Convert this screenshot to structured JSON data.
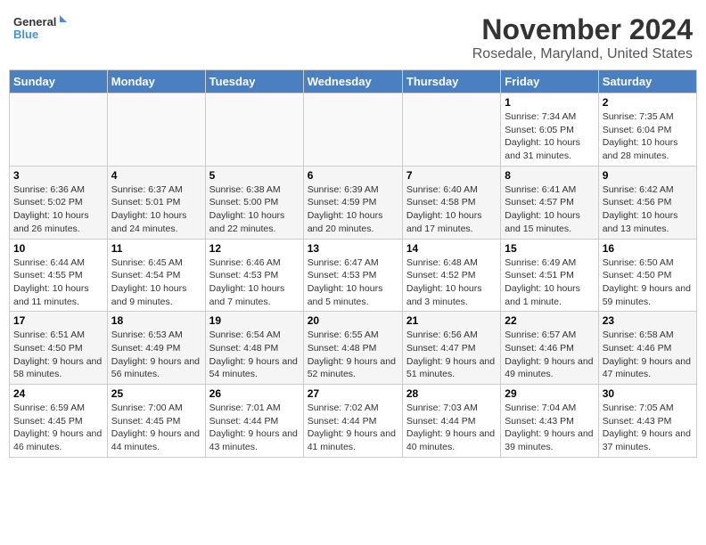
{
  "logo": {
    "general": "General",
    "blue": "Blue"
  },
  "title": "November 2024",
  "location": "Rosedale, Maryland, United States",
  "days_of_week": [
    "Sunday",
    "Monday",
    "Tuesday",
    "Wednesday",
    "Thursday",
    "Friday",
    "Saturday"
  ],
  "weeks": [
    [
      {
        "day": "",
        "detail": ""
      },
      {
        "day": "",
        "detail": ""
      },
      {
        "day": "",
        "detail": ""
      },
      {
        "day": "",
        "detail": ""
      },
      {
        "day": "",
        "detail": ""
      },
      {
        "day": "1",
        "detail": "Sunrise: 7:34 AM\nSunset: 6:05 PM\nDaylight: 10 hours and 31 minutes."
      },
      {
        "day": "2",
        "detail": "Sunrise: 7:35 AM\nSunset: 6:04 PM\nDaylight: 10 hours and 28 minutes."
      }
    ],
    [
      {
        "day": "3",
        "detail": "Sunrise: 6:36 AM\nSunset: 5:02 PM\nDaylight: 10 hours and 26 minutes."
      },
      {
        "day": "4",
        "detail": "Sunrise: 6:37 AM\nSunset: 5:01 PM\nDaylight: 10 hours and 24 minutes."
      },
      {
        "day": "5",
        "detail": "Sunrise: 6:38 AM\nSunset: 5:00 PM\nDaylight: 10 hours and 22 minutes."
      },
      {
        "day": "6",
        "detail": "Sunrise: 6:39 AM\nSunset: 4:59 PM\nDaylight: 10 hours and 20 minutes."
      },
      {
        "day": "7",
        "detail": "Sunrise: 6:40 AM\nSunset: 4:58 PM\nDaylight: 10 hours and 17 minutes."
      },
      {
        "day": "8",
        "detail": "Sunrise: 6:41 AM\nSunset: 4:57 PM\nDaylight: 10 hours and 15 minutes."
      },
      {
        "day": "9",
        "detail": "Sunrise: 6:42 AM\nSunset: 4:56 PM\nDaylight: 10 hours and 13 minutes."
      }
    ],
    [
      {
        "day": "10",
        "detail": "Sunrise: 6:44 AM\nSunset: 4:55 PM\nDaylight: 10 hours and 11 minutes."
      },
      {
        "day": "11",
        "detail": "Sunrise: 6:45 AM\nSunset: 4:54 PM\nDaylight: 10 hours and 9 minutes."
      },
      {
        "day": "12",
        "detail": "Sunrise: 6:46 AM\nSunset: 4:53 PM\nDaylight: 10 hours and 7 minutes."
      },
      {
        "day": "13",
        "detail": "Sunrise: 6:47 AM\nSunset: 4:53 PM\nDaylight: 10 hours and 5 minutes."
      },
      {
        "day": "14",
        "detail": "Sunrise: 6:48 AM\nSunset: 4:52 PM\nDaylight: 10 hours and 3 minutes."
      },
      {
        "day": "15",
        "detail": "Sunrise: 6:49 AM\nSunset: 4:51 PM\nDaylight: 10 hours and 1 minute."
      },
      {
        "day": "16",
        "detail": "Sunrise: 6:50 AM\nSunset: 4:50 PM\nDaylight: 9 hours and 59 minutes."
      }
    ],
    [
      {
        "day": "17",
        "detail": "Sunrise: 6:51 AM\nSunset: 4:50 PM\nDaylight: 9 hours and 58 minutes."
      },
      {
        "day": "18",
        "detail": "Sunrise: 6:53 AM\nSunset: 4:49 PM\nDaylight: 9 hours and 56 minutes."
      },
      {
        "day": "19",
        "detail": "Sunrise: 6:54 AM\nSunset: 4:48 PM\nDaylight: 9 hours and 54 minutes."
      },
      {
        "day": "20",
        "detail": "Sunrise: 6:55 AM\nSunset: 4:48 PM\nDaylight: 9 hours and 52 minutes."
      },
      {
        "day": "21",
        "detail": "Sunrise: 6:56 AM\nSunset: 4:47 PM\nDaylight: 9 hours and 51 minutes."
      },
      {
        "day": "22",
        "detail": "Sunrise: 6:57 AM\nSunset: 4:46 PM\nDaylight: 9 hours and 49 minutes."
      },
      {
        "day": "23",
        "detail": "Sunrise: 6:58 AM\nSunset: 4:46 PM\nDaylight: 9 hours and 47 minutes."
      }
    ],
    [
      {
        "day": "24",
        "detail": "Sunrise: 6:59 AM\nSunset: 4:45 PM\nDaylight: 9 hours and 46 minutes."
      },
      {
        "day": "25",
        "detail": "Sunrise: 7:00 AM\nSunset: 4:45 PM\nDaylight: 9 hours and 44 minutes."
      },
      {
        "day": "26",
        "detail": "Sunrise: 7:01 AM\nSunset: 4:44 PM\nDaylight: 9 hours and 43 minutes."
      },
      {
        "day": "27",
        "detail": "Sunrise: 7:02 AM\nSunset: 4:44 PM\nDaylight: 9 hours and 41 minutes."
      },
      {
        "day": "28",
        "detail": "Sunrise: 7:03 AM\nSunset: 4:44 PM\nDaylight: 9 hours and 40 minutes."
      },
      {
        "day": "29",
        "detail": "Sunrise: 7:04 AM\nSunset: 4:43 PM\nDaylight: 9 hours and 39 minutes."
      },
      {
        "day": "30",
        "detail": "Sunrise: 7:05 AM\nSunset: 4:43 PM\nDaylight: 9 hours and 37 minutes."
      }
    ]
  ]
}
